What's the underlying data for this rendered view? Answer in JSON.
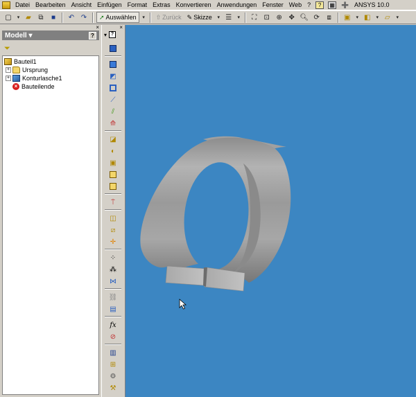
{
  "menubar": {
    "items": [
      "Datei",
      "Bearbeiten",
      "Ansicht",
      "Einfügen",
      "Format",
      "Extras",
      "Konvertieren",
      "Anwendungen",
      "Fenster",
      "Web",
      "?"
    ],
    "ansys_label": "ANSYS 10.0"
  },
  "toolbar": {
    "select_label": "Auswählen",
    "back_label": "Zurück",
    "sketch_label": "Skizze"
  },
  "model_panel": {
    "title": "Modell",
    "help_label": "?",
    "close_label": "×",
    "tree": [
      {
        "label": "Bauteil1",
        "icon": "part-icon",
        "expander": ""
      },
      {
        "label": "Ursprung",
        "icon": "folder-icon",
        "expander": "+"
      },
      {
        "label": "Konturlasche1",
        "icon": "sheet-metal-icon",
        "expander": "+"
      },
      {
        "label": "Bauteilende",
        "icon": "error-icon",
        "expander": ""
      }
    ]
  },
  "tool_panel": {
    "close_label": "×",
    "help_label": "?",
    "fx_label": "fx"
  },
  "colors": {
    "viewport_bg": "#3c86c2",
    "part_grey": "#a8a8a8",
    "ui_face": "#d4d0c8"
  }
}
